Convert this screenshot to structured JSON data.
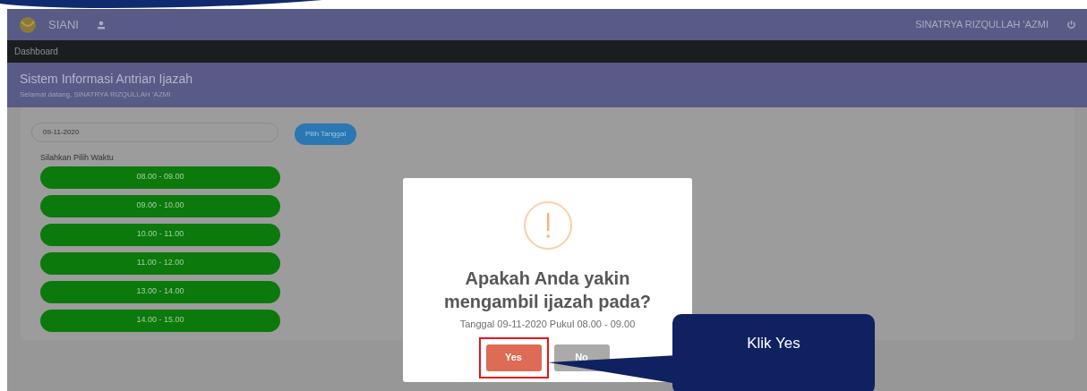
{
  "navbar": {
    "brand": "SIANI",
    "user": "SINATRYA RIZQULLAH 'AZMI"
  },
  "breadcrumb": "Dashboard",
  "header": {
    "title": "Sistem Informasi Antrian Ijazah",
    "subtitle": "Selamat datang, SINATRYA RIZQULLAH 'AZMI"
  },
  "date_field": {
    "value": "09-11-2020"
  },
  "pick_button": "Pilih Tanggal",
  "slots_label": "Silahkan Pilih Waktu",
  "slots": [
    "08.00 - 09.00",
    "09.00 - 10.00",
    "10.00 - 11.00",
    "11.00 - 12.00",
    "13.00 - 14.00",
    "14.00 - 15.00"
  ],
  "dialog": {
    "title": "Apakah Anda yakin mengambil ijazah pada?",
    "message": "Tanggal 09-11-2020 Pukul 08.00 - 09.00",
    "buttons": [
      {
        "label": "Yes",
        "kind": "confirm",
        "highlighted": true
      },
      {
        "label": "No",
        "kind": "cancel",
        "highlighted": false
      }
    ]
  },
  "callout": {
    "text": "Klik Yes"
  }
}
